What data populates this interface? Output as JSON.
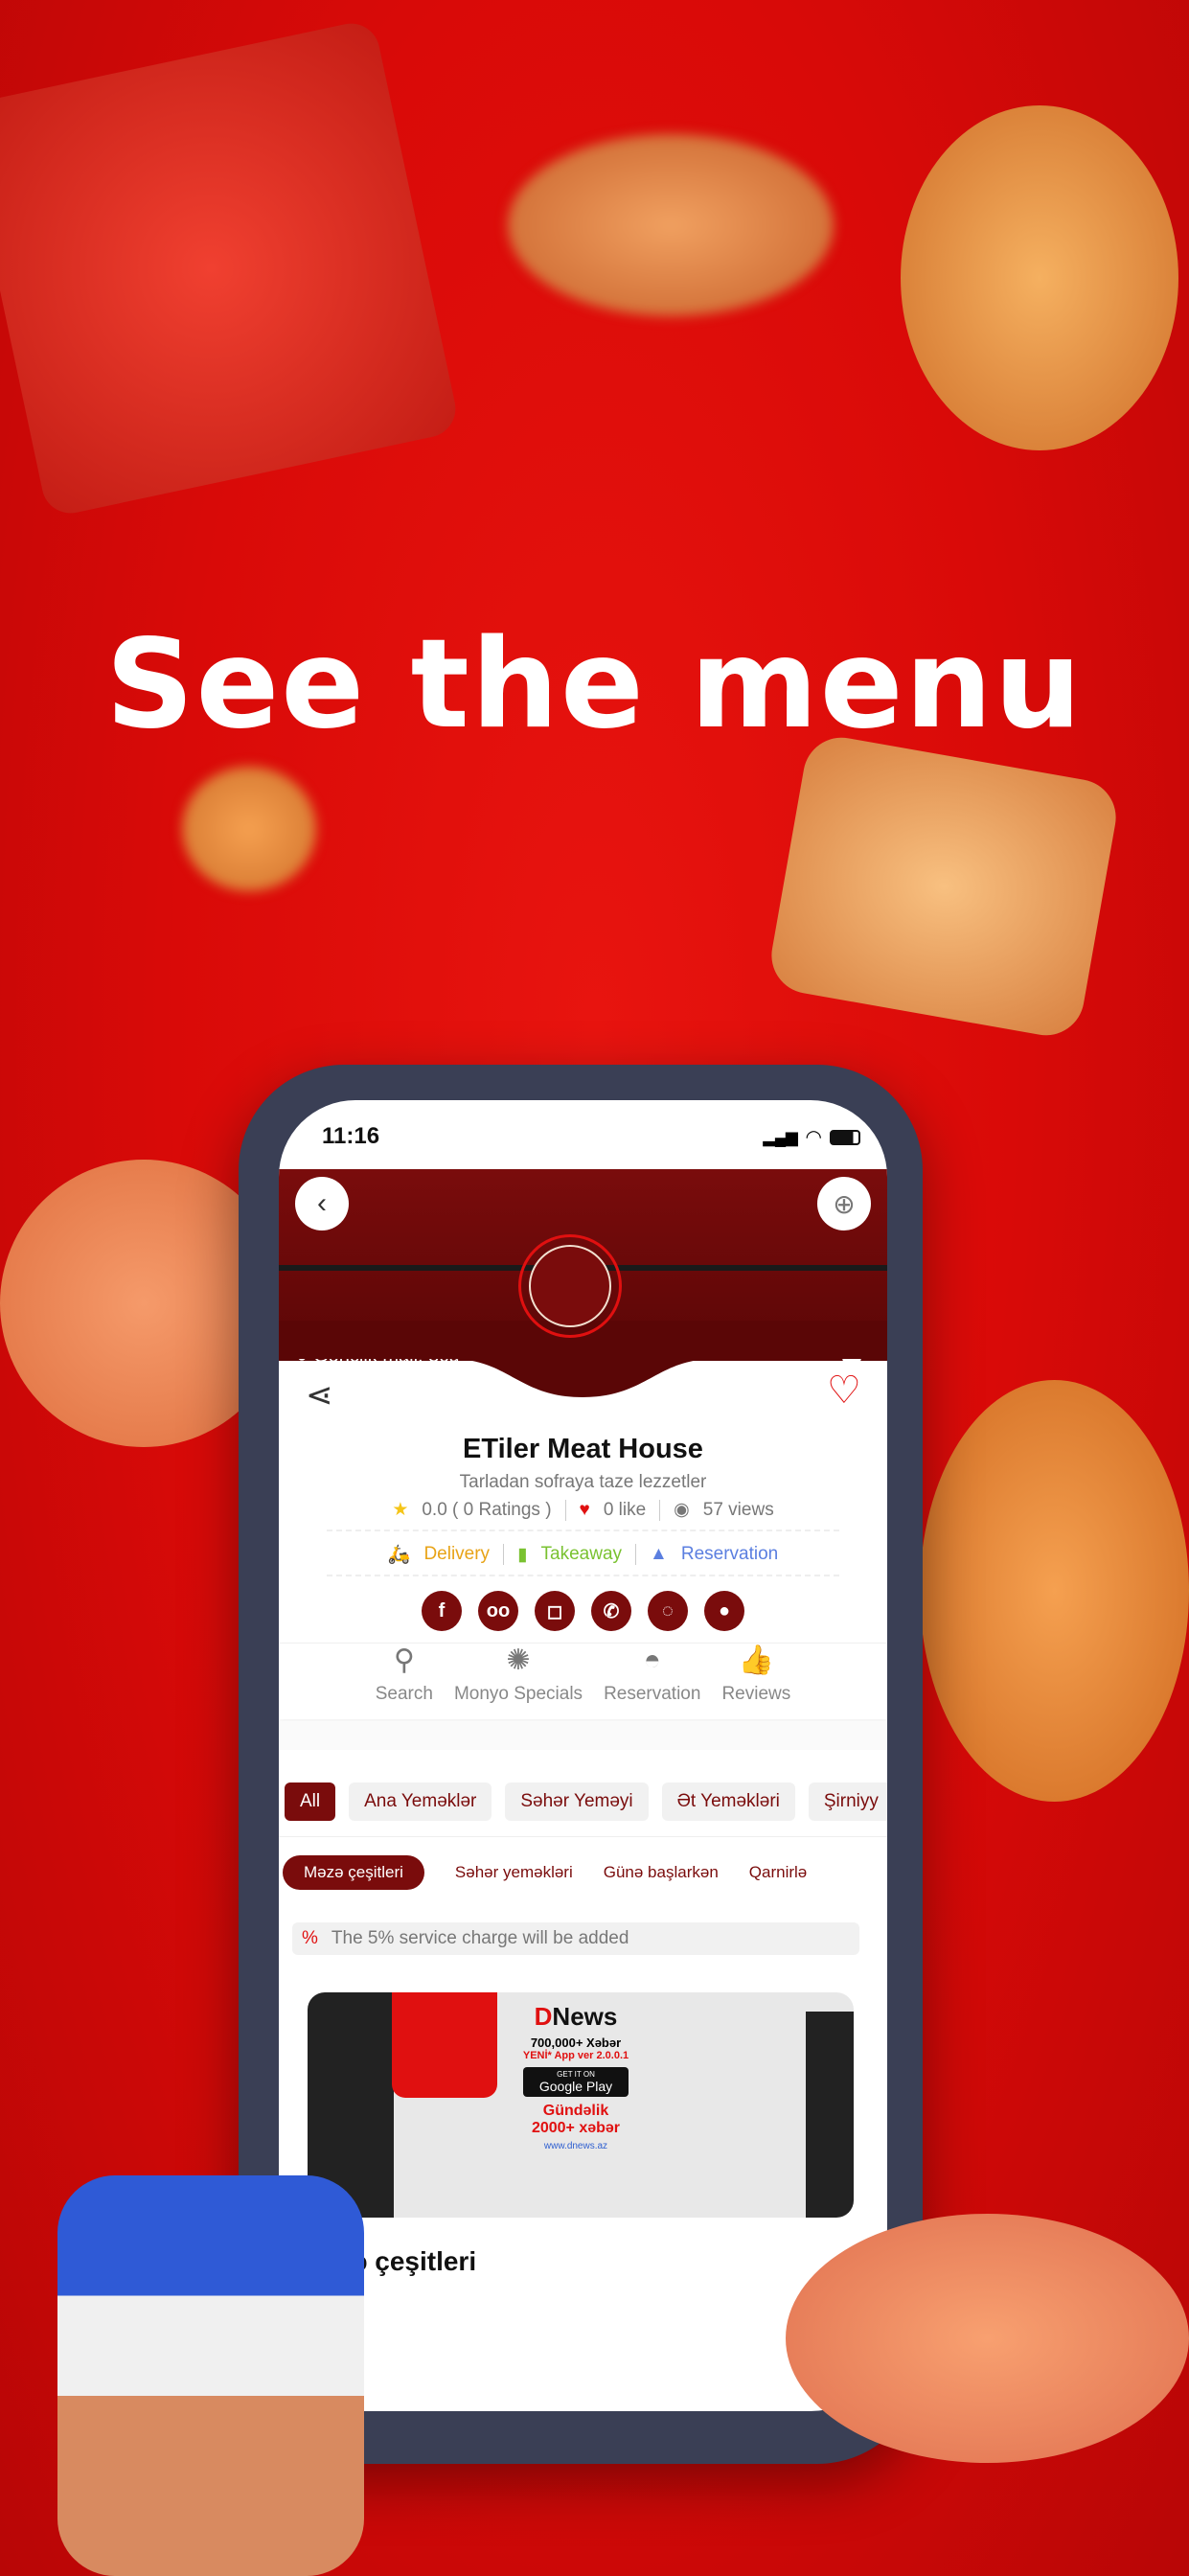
{
  "headline": "See the menu",
  "status": {
    "time": "11:16"
  },
  "header": {
    "location": "Gənclik mall, 3cü",
    "hours": "-"
  },
  "restaurant": {
    "name": "ETiler Meat House",
    "tagline": "Tarladan sofraya taze lezzetler",
    "rating": "0.0 ( 0 Ratings )",
    "likes": "0 like",
    "views": "57 views"
  },
  "services": [
    {
      "label": "Delivery",
      "color": "#e8a317"
    },
    {
      "label": "Takeaway",
      "color": "#7ac231"
    },
    {
      "label": "Reservation",
      "color": "#5b7fe0"
    }
  ],
  "social": [
    "facebook",
    "tripadvisor",
    "instagram",
    "phone",
    "whatsapp",
    "location"
  ],
  "nav": [
    {
      "label": "Search",
      "icon": "search-icon"
    },
    {
      "label": "Monyo Specials",
      "icon": "badge-like-icon"
    },
    {
      "label": "Reservation",
      "icon": "cloche-icon"
    },
    {
      "label": "Reviews",
      "icon": "thumbs-up-stars-icon"
    }
  ],
  "categories": [
    "All",
    "Ana Yeməklər",
    "Səhər Yeməyi",
    "Ət Yeməkləri",
    "Şirniyy"
  ],
  "subcategories": [
    "Məzə çeşitleri",
    "Səhər yeməkləri",
    "Günə başlarkən",
    "Qarnirlə"
  ],
  "notice": "The 5% service charge will be added",
  "ad": {
    "brand": "News",
    "line1": "700,000+ Xəbər",
    "line2": "YENİ* App ver 2.0.0.1",
    "store": "Google Play",
    "store_top": "GET IT ON",
    "line3": "Gündəlik",
    "line4": "2000+ xəbər",
    "url": "www.dnews.az"
  },
  "section_title": "Məzə çeşitleri",
  "colors": {
    "brand": "#7a0c0c",
    "background": "#d90a08",
    "heart": "#e01010"
  }
}
